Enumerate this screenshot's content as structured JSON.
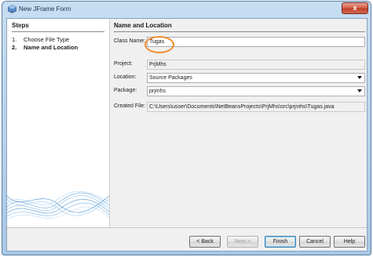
{
  "window": {
    "title": "New JFrame Form",
    "close_glyph": "x",
    "app_icon": "netbeans-cube-icon"
  },
  "steps": {
    "title": "Steps",
    "items": [
      {
        "num": "1.",
        "label": "Choose File Type"
      },
      {
        "num": "2.",
        "label": "Name and Location"
      }
    ]
  },
  "form": {
    "section_title": "Name and Location",
    "class_name_label": "Class Name:",
    "class_name_value": "Tugas",
    "project_label": "Project:",
    "project_value": "PrjMhs",
    "location_label": "Location:",
    "location_value": "Source Packages",
    "package_label": "Package:",
    "package_value": "prjmhs",
    "created_file_label": "Created File:",
    "created_file_value": "C:\\Users\\usser\\Documents\\NetBeansProjects\\PrjMhs\\src\\prjmhs\\Tugas.java"
  },
  "buttons": {
    "back": "< Back",
    "next": "Next >",
    "finish": "Finish",
    "cancel": "Cancel",
    "help": "Help"
  },
  "colors": {
    "highlight_circle": "#f08a2c",
    "title_bar": "#a9c8e6",
    "close_button": "#c0402a"
  }
}
